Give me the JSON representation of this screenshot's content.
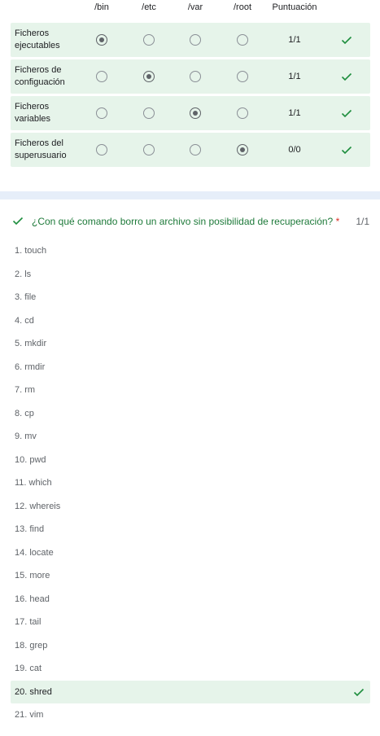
{
  "grid_question": {
    "columns": [
      "/bin",
      "/etc",
      "/var",
      "/root",
      "Puntuación"
    ],
    "rows": [
      {
        "label": "Ficheros ejecutables",
        "selected": 0,
        "score": "1/1",
        "correct": true
      },
      {
        "label": "Ficheros de configuación",
        "selected": 1,
        "score": "1/1",
        "correct": true
      },
      {
        "label": "Ficheros variables",
        "selected": 2,
        "score": "1/1",
        "correct": true
      },
      {
        "label": "Ficheros del superusuario",
        "selected": 3,
        "score": "0/0",
        "correct": true
      }
    ]
  },
  "mc_question": {
    "title": "¿Con qué comando borro un archivo sin posibilidad de recuperación?",
    "required_marker": "*",
    "score": "1/1",
    "correct_icon": "check-icon",
    "options": [
      {
        "label": "1. touch",
        "correct": false
      },
      {
        "label": "2. ls",
        "correct": false
      },
      {
        "label": "3. file",
        "correct": false
      },
      {
        "label": "4. cd",
        "correct": false
      },
      {
        "label": "5. mkdir",
        "correct": false
      },
      {
        "label": "6. rmdir",
        "correct": false
      },
      {
        "label": "7. rm",
        "correct": false
      },
      {
        "label": "8. cp",
        "correct": false
      },
      {
        "label": "9. mv",
        "correct": false
      },
      {
        "label": "10. pwd",
        "correct": false
      },
      {
        "label": "11. which",
        "correct": false
      },
      {
        "label": "12. whereis",
        "correct": false
      },
      {
        "label": "13. find",
        "correct": false
      },
      {
        "label": "14. locate",
        "correct": false
      },
      {
        "label": "15. more",
        "correct": false
      },
      {
        "label": "16. head",
        "correct": false
      },
      {
        "label": "17. tail",
        "correct": false
      },
      {
        "label": "18. grep",
        "correct": false
      },
      {
        "label": "19. cat",
        "correct": false
      },
      {
        "label": "20. shred",
        "correct": true
      },
      {
        "label": "21. vim",
        "correct": false
      }
    ]
  },
  "colors": {
    "correct_green": "#1e8e3e",
    "correct_bg": "#e6f4ea",
    "separator": "#e6eef9",
    "required_red": "#d93025"
  }
}
